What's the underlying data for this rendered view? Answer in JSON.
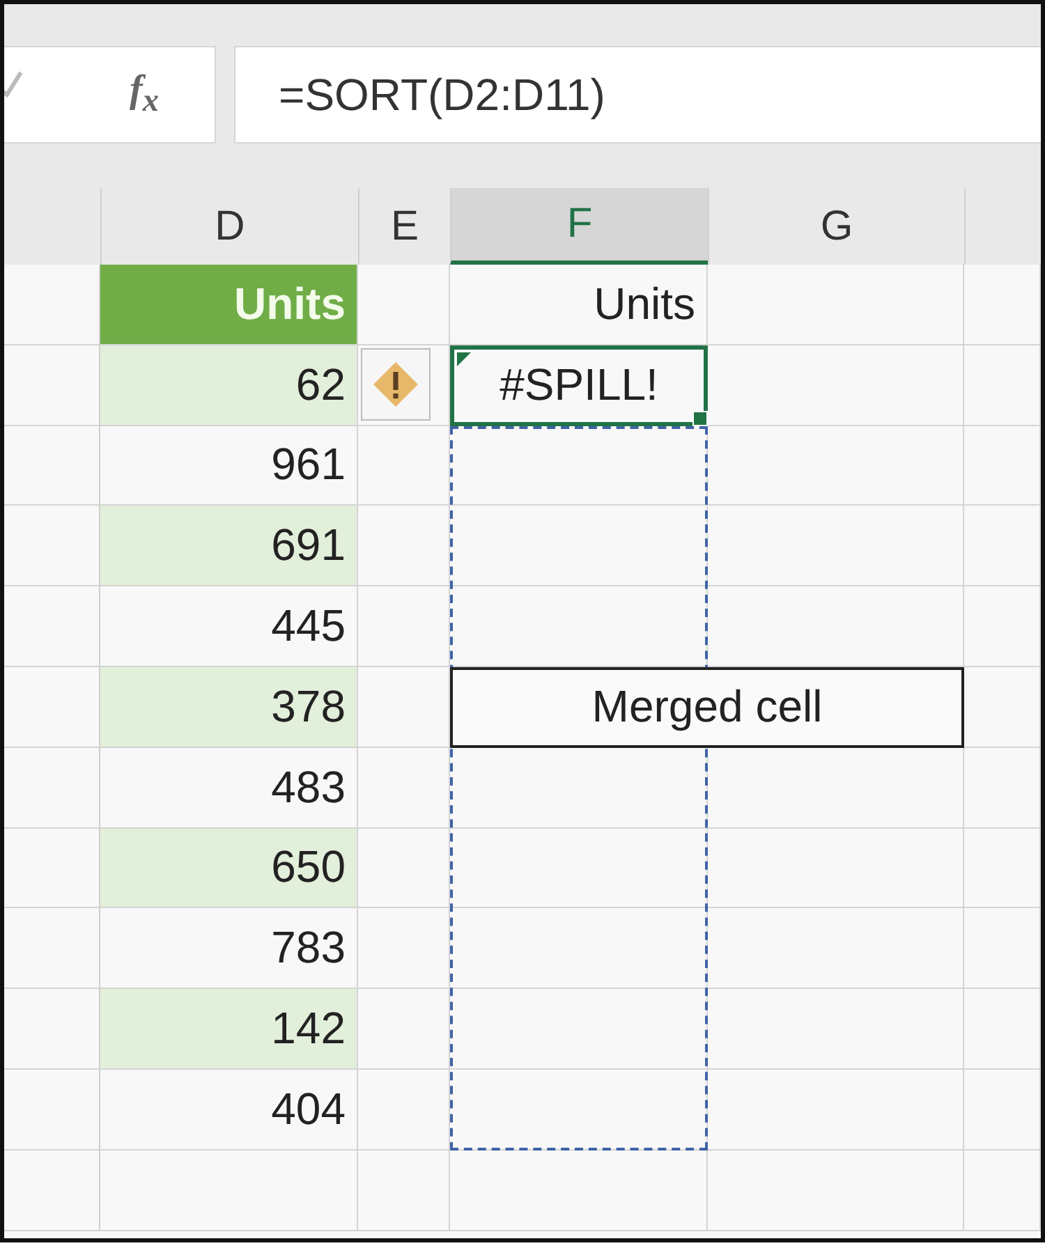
{
  "formula_bar": {
    "function_label": "f$_{x}$",
    "formula": "=SORT(D2:D11)"
  },
  "columns": [
    {
      "label": "D",
      "selected": false
    },
    {
      "label": "E",
      "selected": false
    },
    {
      "label": "F",
      "selected": true
    },
    {
      "label": "G",
      "selected": false
    }
  ],
  "header_row": {
    "d": "Units",
    "f": "Units"
  },
  "spill_cell": {
    "value": "#SPILL!",
    "selected": true,
    "error": true,
    "warning": true
  },
  "rows": [
    {
      "d": "62",
      "shaded": true
    },
    {
      "d": "961",
      "shaded": false
    },
    {
      "d": "691",
      "shaded": true
    },
    {
      "d": "445",
      "shaded": false
    },
    {
      "d": "378",
      "shaded": true,
      "merged": "Merged cell"
    },
    {
      "d": "483",
      "shaded": false
    },
    {
      "d": "650",
      "shaded": true
    },
    {
      "d": "783",
      "shaded": false
    },
    {
      "d": "142",
      "shaded": true
    },
    {
      "d": "404",
      "shaded": false
    }
  ]
}
